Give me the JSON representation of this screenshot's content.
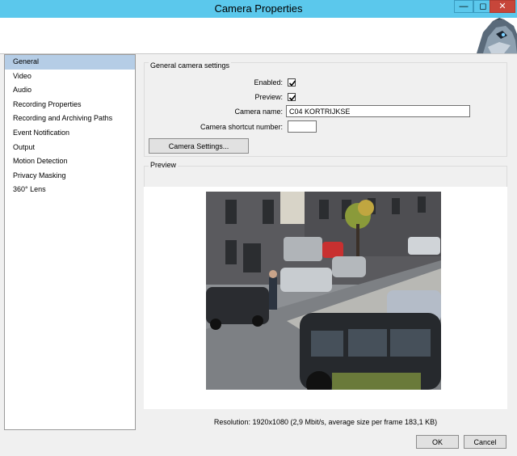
{
  "window": {
    "title": "Camera Properties"
  },
  "sidebar": {
    "items": [
      {
        "label": "General",
        "selected": true
      },
      {
        "label": "Video"
      },
      {
        "label": "Audio"
      },
      {
        "label": "Recording Properties"
      },
      {
        "label": "Recording and Archiving Paths"
      },
      {
        "label": "Event Notification"
      },
      {
        "label": "Output"
      },
      {
        "label": "Motion Detection"
      },
      {
        "label": "Privacy Masking"
      },
      {
        "label": "360° Lens"
      }
    ]
  },
  "general": {
    "section_title": "General camera settings",
    "enabled_label": "Enabled:",
    "enabled_checked": true,
    "preview_label": "Preview:",
    "preview_checked": true,
    "camera_name_label": "Camera name:",
    "camera_name_value": "C04 KORTRIJKSE",
    "shortcut_label": "Camera shortcut number:",
    "shortcut_value": "",
    "camera_settings_button": "Camera Settings..."
  },
  "preview": {
    "section_title": "Preview",
    "resolution_text": "Resolution: 1920x1080  (2,9 Mbit/s, average size per frame 183,1 KB)"
  },
  "footer": {
    "ok_label": "OK",
    "cancel_label": "Cancel"
  },
  "icons": {
    "minimize": "minimize-icon",
    "maximize": "maximize-icon",
    "close": "close-icon"
  },
  "colors": {
    "titlebar": "#5bc8ec",
    "close": "#c7463a",
    "selection": "#b5cde6"
  }
}
